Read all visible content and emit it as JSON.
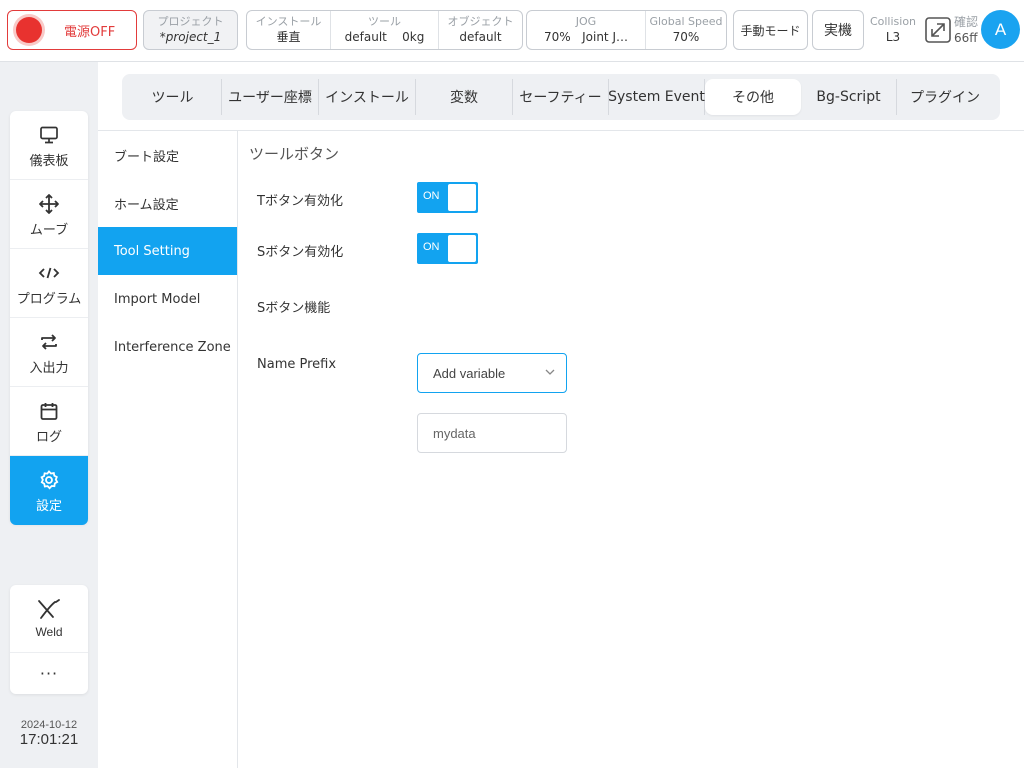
{
  "topbar": {
    "power_label": "電源OFF",
    "project_title": "プロジェクト",
    "project_value": "*project_1",
    "install_title": "インストール",
    "install_value": "垂直",
    "tool_title": "ツール",
    "tool_value": "default",
    "tool_weight": "0kg",
    "object_title": "オブジェクト",
    "object_value": "default",
    "jog_title": "JOG",
    "jog_speed": "70%",
    "jog_mode": "Joint J…",
    "global_speed_title": "Global Speed",
    "global_speed_value": "70%",
    "manual_mode_label": "手動モード",
    "real_label": "実機",
    "collision_title": "Collision",
    "collision_value": "L3",
    "confirm_title": "確認",
    "confirm_value": "66ff",
    "avatar_letter": "A",
    "colors": {
      "power_red": "#e23b3b",
      "accent_blue": "#12a3f0"
    }
  },
  "leftnav": {
    "items": [
      {
        "label": "儀表板",
        "icon": "monitor-icon"
      },
      {
        "label": "ムーブ",
        "icon": "move-arrows-icon"
      },
      {
        "label": "プログラム",
        "icon": "code-icon"
      },
      {
        "label": "入出力",
        "icon": "swap-arrows-icon"
      },
      {
        "label": "ログ",
        "icon": "calendar-icon"
      },
      {
        "label": "設定",
        "icon": "gear-icon"
      }
    ],
    "weld_label": "Weld",
    "more_label": "···"
  },
  "datetime": {
    "date": "2024-10-12",
    "time": "17:01:21"
  },
  "tabs": [
    {
      "label": "ツール"
    },
    {
      "label": "ユーザー座標"
    },
    {
      "label": "インストール"
    },
    {
      "label": "変数"
    },
    {
      "label": "セーフティー"
    },
    {
      "label": "System Event"
    },
    {
      "label": "その他"
    },
    {
      "label": "Bg-Script"
    },
    {
      "label": "プラグイン"
    }
  ],
  "sublist": [
    {
      "label": "ブート設定"
    },
    {
      "label": "ホーム設定"
    },
    {
      "label": "Tool Setting"
    },
    {
      "label": "Import Model"
    },
    {
      "label": "Interference Zone"
    }
  ],
  "content": {
    "section_title": "ツールボタン",
    "t_button_label": "Tボタン有効化",
    "t_button_state": "ON",
    "s_button_label": "Sボタン有効化",
    "s_button_state": "ON",
    "s_function_label": "Sボタン機能",
    "s_function_value": "Add variable",
    "name_prefix_label": "Name Prefix",
    "name_prefix_value": "mydata"
  }
}
